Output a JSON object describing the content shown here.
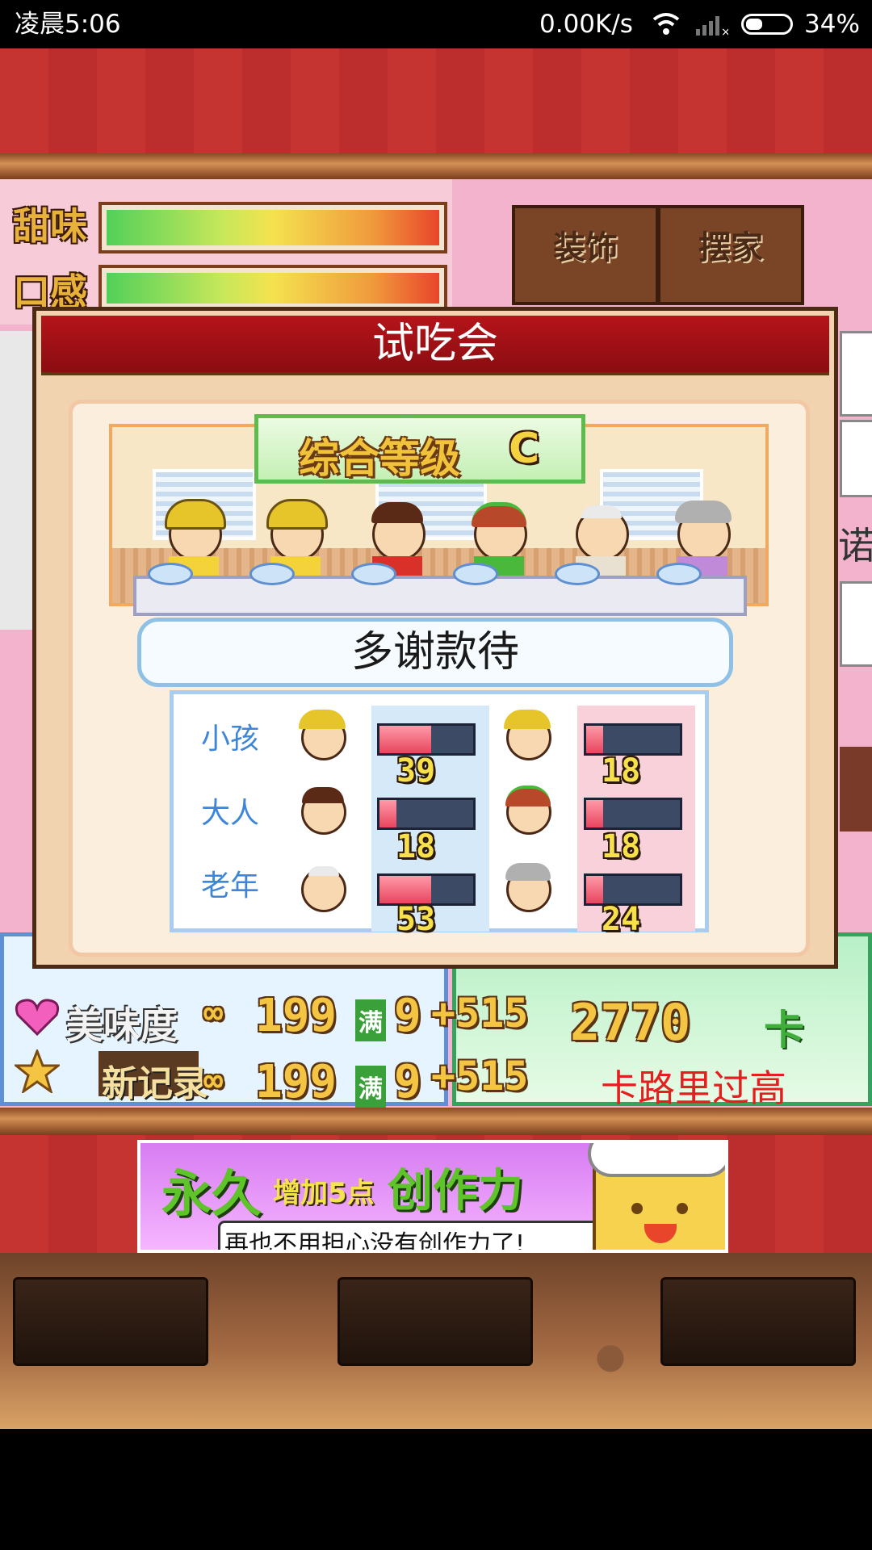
{
  "status_bar": {
    "time": "凌晨5:06",
    "network_speed": "0.00K/s",
    "battery": "34%"
  },
  "meters": [
    {
      "label": "甜味",
      "level_percent": 100
    },
    {
      "label": "口感",
      "level_percent": 100
    }
  ],
  "menu_buttons": [
    {
      "label": "装饰"
    },
    {
      "label": "摆家"
    }
  ],
  "side_text": "诺",
  "stats_behind": {
    "rows": [
      {
        "label": "美味度",
        "infinity": "∞",
        "value": "199",
        "max": "满",
        "level": "9",
        "bonus": "+515"
      },
      {
        "label": "新记录",
        "infinity": "∞",
        "value": "199",
        "max": "满",
        "level": "9",
        "bonus": "+515"
      }
    ],
    "calories_value": "2770",
    "card_label": "卡",
    "calories_warning": "卡路里过高"
  },
  "ad": {
    "headline_a": "永久",
    "headline_b": "增加5点",
    "headline_c": "创作力",
    "subline": "再也不用担心没有创作力了!"
  },
  "dialog": {
    "title": "试吃会",
    "grade_label": "综合等级",
    "grade_value": "C",
    "speech": "多谢款待",
    "rows": [
      {
        "label": "小孩",
        "male_value": "39",
        "male_level": 0.55,
        "female_value": "18",
        "female_level": 0.18
      },
      {
        "label": "大人",
        "male_value": "18",
        "male_level": 0.18,
        "female_value": "18",
        "female_level": 0.18
      },
      {
        "label": "老年",
        "male_value": "53",
        "male_level": 0.55,
        "female_value": "24",
        "female_level": 0.18
      }
    ]
  },
  "colors": {
    "title_red": "#b5141a",
    "label_blue": "#3f86d8",
    "grade_green": "#5dbc4d"
  }
}
